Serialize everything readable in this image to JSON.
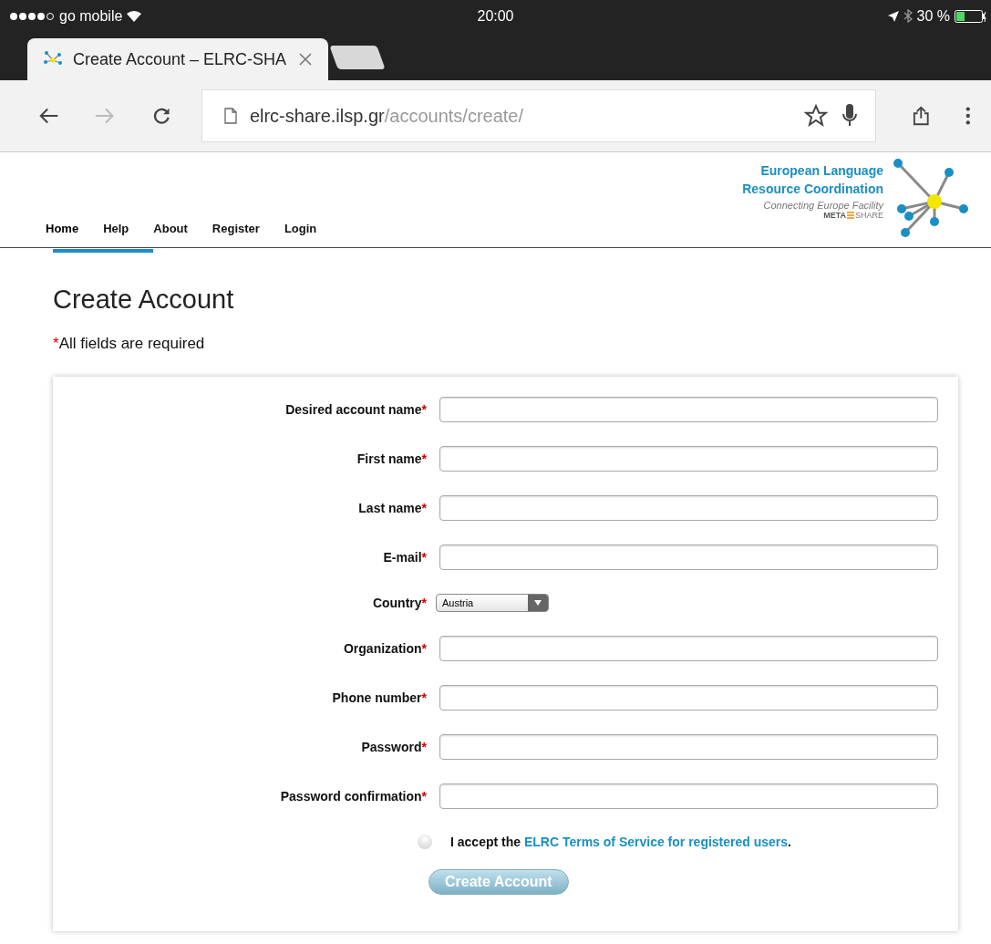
{
  "status_bar": {
    "carrier": "go mobile",
    "time": "20:00",
    "battery": "30 %"
  },
  "browser": {
    "tab_title": "Create Account – ELRC-SHA",
    "url_host": "elrc-share.ilsp.gr",
    "url_path": "/accounts/create/"
  },
  "logo": {
    "line_1": "European Language",
    "line_2": "Resource Coordination",
    "tagline": "Connecting Europe Facility",
    "meta": "META",
    "share": "SHARE"
  },
  "nav": [
    {
      "label": "Home",
      "selected": true
    },
    {
      "label": "Help",
      "selected": false
    },
    {
      "label": "About",
      "selected": false
    },
    {
      "label": "Register",
      "selected": false
    },
    {
      "label": "Login",
      "selected": false
    }
  ],
  "heading": "Create Account",
  "required_note": {
    "mark": "*",
    "text": "All fields are required"
  },
  "fields": [
    {
      "label": "Desired account name",
      "mark": "*",
      "kind": "text"
    },
    {
      "label": "First name",
      "mark": "*",
      "kind": "text"
    },
    {
      "label": "Last name",
      "mark": "*",
      "kind": "text"
    },
    {
      "label": "E-mail",
      "mark": "*",
      "kind": "text"
    },
    {
      "label": "Country",
      "mark": "*",
      "kind": "select",
      "value": "Austria"
    },
    {
      "label": "Organization",
      "mark": "*",
      "kind": "text"
    },
    {
      "label": "Phone number",
      "mark": "*",
      "kind": "text"
    },
    {
      "label": "Password",
      "mark": "*",
      "kind": "text"
    },
    {
      "label": "Password confirmation",
      "mark": "*",
      "kind": "text"
    }
  ],
  "terms": {
    "checked": false,
    "prefix": "I accept the",
    "link": "ELRC Terms of Service for registered users",
    "suffix": "."
  },
  "submit": "Create Account"
}
